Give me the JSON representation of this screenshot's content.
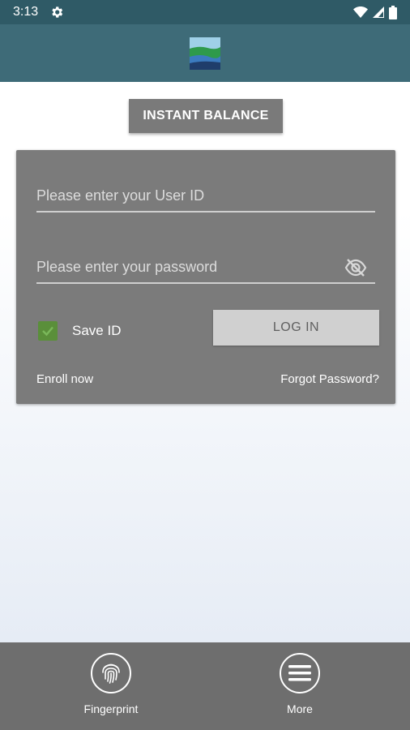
{
  "status_bar": {
    "time": "3:13",
    "icons": [
      "settings-gear-icon",
      "wifi-icon",
      "cellular-signal-icon",
      "battery-icon"
    ]
  },
  "app_bar": {
    "logo_icon": "bank-landscape-logo",
    "colors": {
      "status": "#2f5a66",
      "header": "#3e6b78"
    }
  },
  "instant_balance": {
    "label": "INSTANT BALANCE"
  },
  "login": {
    "user_id_placeholder": "Please enter your User ID",
    "password_placeholder": "Please enter your password",
    "password_visibility_icon": "eye-off-icon",
    "save_id_label": "Save ID",
    "save_id_checked": true,
    "login_label": "LOG IN",
    "enroll_label": "Enroll now",
    "forgot_label": "Forgot Password?"
  },
  "bottom_nav": {
    "items": [
      {
        "label": "Fingerprint",
        "icon": "fingerprint-icon"
      },
      {
        "label": "More",
        "icon": "hamburger-menu-icon"
      }
    ]
  }
}
